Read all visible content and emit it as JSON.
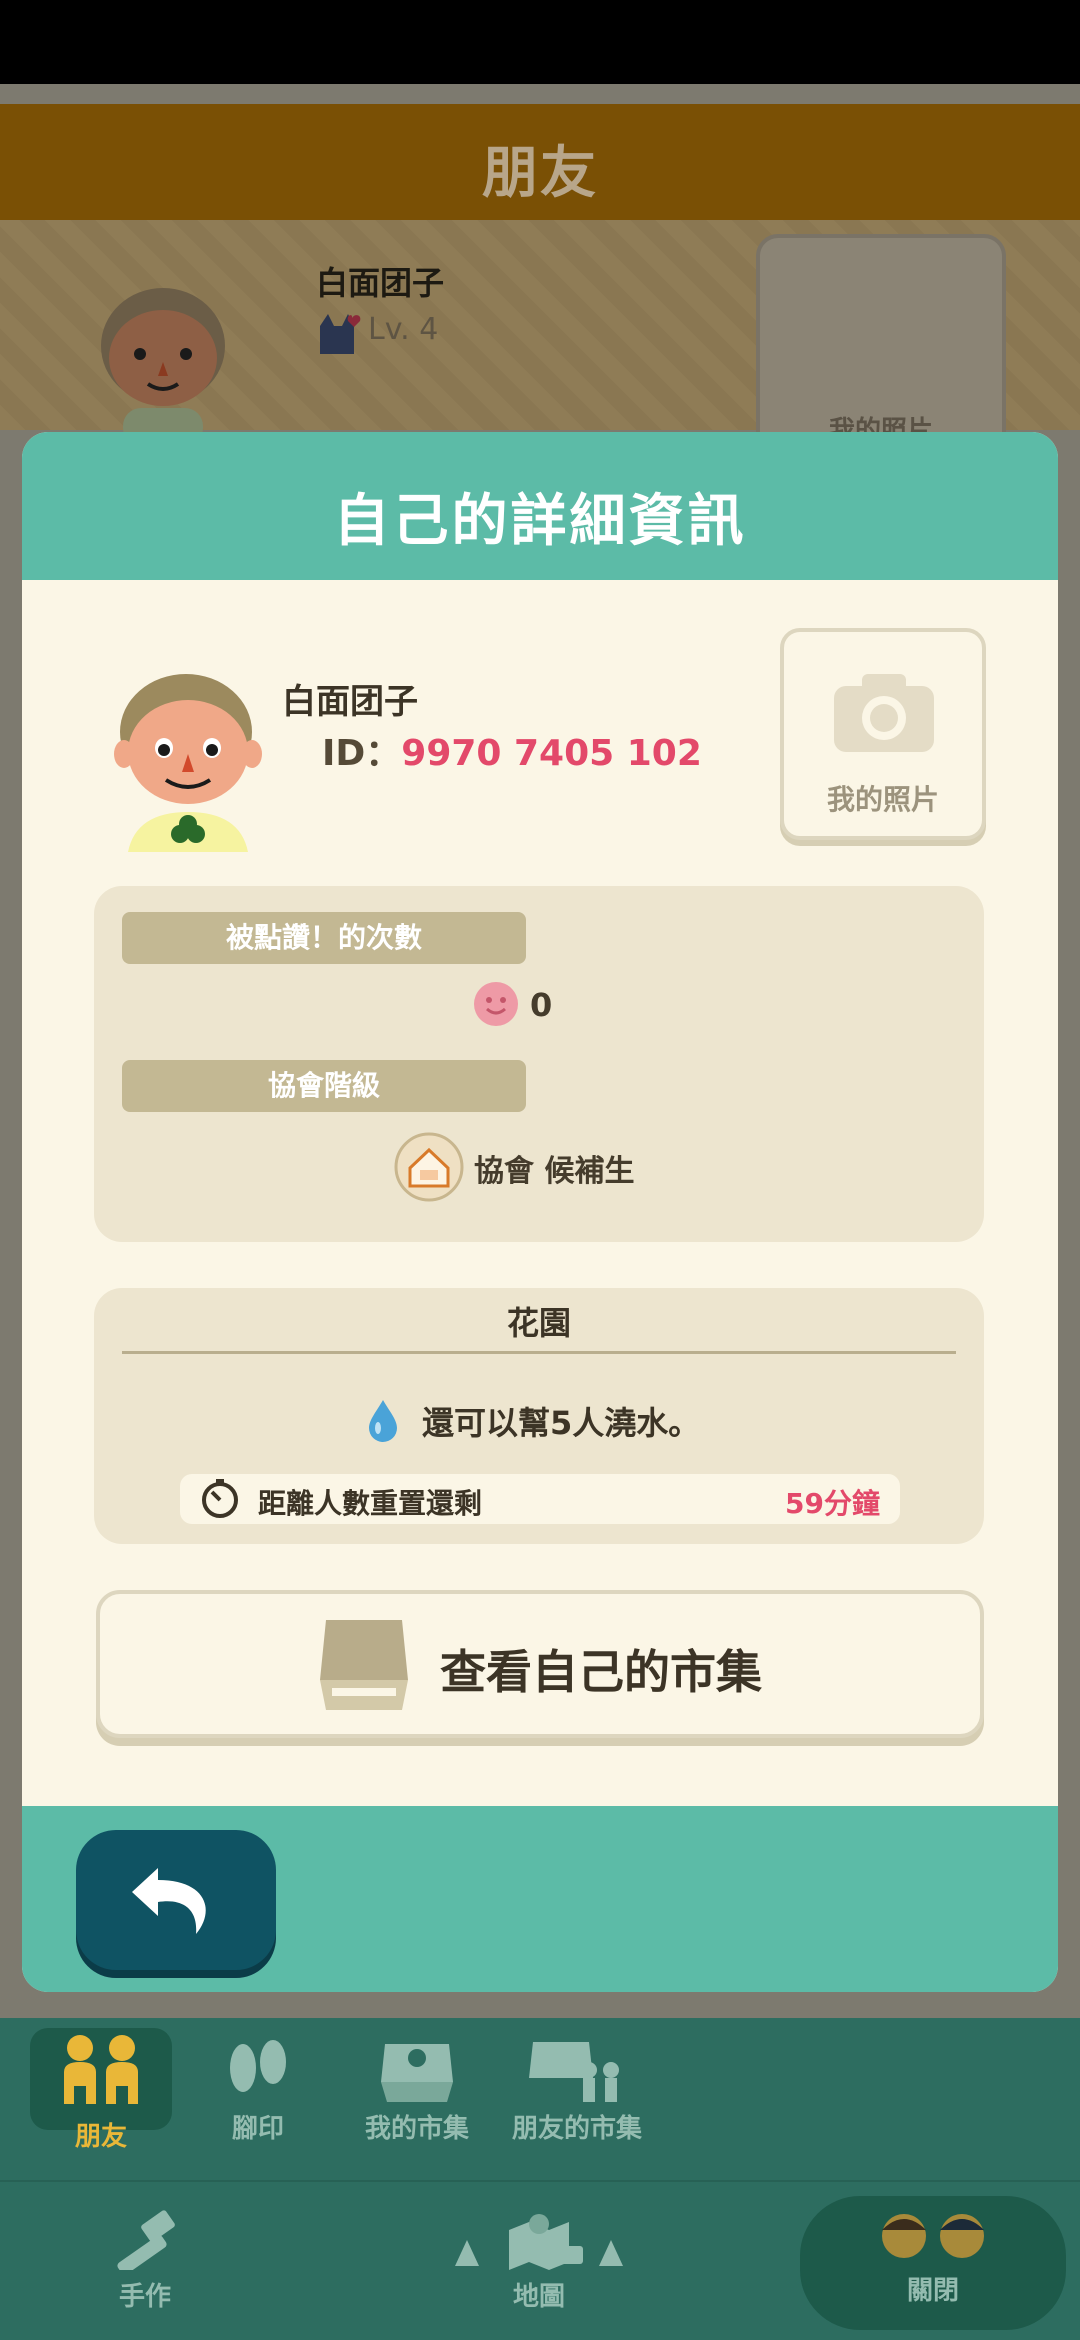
{
  "background": {
    "header_title": "朋友",
    "player_name": "白面团子",
    "level": "Lv. 4",
    "photo_label": "我的照片"
  },
  "dialog": {
    "title": "自己的詳細資訊",
    "name": "白面团子",
    "id_label": "ID：",
    "id_value": "9970 7405 102",
    "photo_button": "我的照片",
    "likes": {
      "label": "被點讚！的次數",
      "count": "0"
    },
    "rank": {
      "label": "協會階級",
      "value": "協會 候補生"
    },
    "garden": {
      "title": "花園",
      "water_text": "還可以幫5人澆水。",
      "timer_label": "距離人數重置還剩",
      "timer_value": "59分鐘"
    },
    "market_button": "查看自己的市集",
    "back_button": "back-arrow-icon"
  },
  "nav": {
    "friends": "朋友",
    "footprint": "腳印",
    "my_market": "我的市集",
    "friends_market": "朋友的市集",
    "craft": "手作",
    "map": "地圖",
    "close": "關閉"
  },
  "colors": {
    "accent_teal": "#5cbba7",
    "highlight_pink": "#e3496a",
    "back_button": "#0f5363"
  }
}
